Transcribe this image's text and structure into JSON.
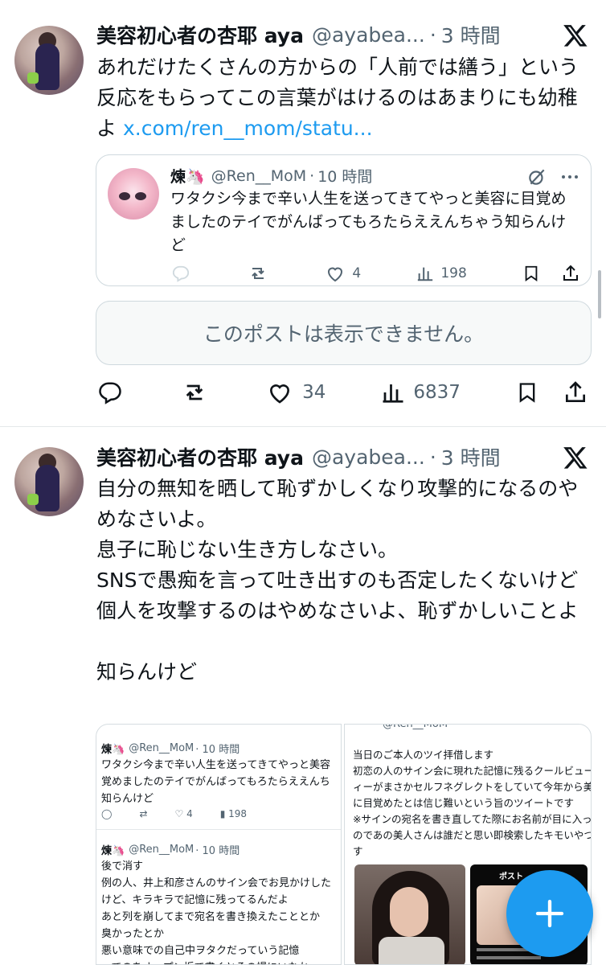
{
  "post1": {
    "author_name": "美容初心者の杏耶 aya",
    "handle": "@ayabea...",
    "dot": "·",
    "time": "3 時間",
    "text": "あれだけたくさんの方からの「人前では繕う」という反応をもらってこの言葉がはけるのはあまりにも幼稚よ ",
    "link": "x.com/ren__mom/statu...",
    "quote": {
      "author_name": "煉🦄",
      "handle": "@Ren__MoM",
      "dot": "·",
      "time": "10 時間",
      "text": "ワタクシ今まで辛い人生を送ってきてやっと美容に目覚めましたのテイでがんばってもろたらええんちゃう知らんけど",
      "likes": "4",
      "views": "198"
    },
    "unavailable": "このポストは表示できません。",
    "likes": "34",
    "views": "6837"
  },
  "post2": {
    "author_name": "美容初心者の杏耶 aya",
    "handle": "@ayabea...",
    "dot": "·",
    "time": "3 時間",
    "text": "自分の無知を晒して恥ずかしくなり攻撃的になるのやめなさいよ。\n息子に恥じない生き方しなさい。\nSNSで愚痴を言って吐き出すのも否定したくないけど個人を攻撃するのはやめなさいよ、恥ずかしいことよ\n\n知らんけど",
    "media_left": {
      "tweet1_name": "煉🦄",
      "tweet1_handle": "@Ren__MoM",
      "tweet1_time": "· 10 時間",
      "tweet1_text": "ワタクシ今まで辛い人生を送ってきてやっと美容\n覚めましたのテイでがんばってもろたらええんち\n知らんけど",
      "tweet1_likes": "4",
      "tweet1_views": "198",
      "tweet2_name": "煉🦄",
      "tweet2_handle": "@Ren__MoM",
      "tweet2_time": "· 10 時間",
      "tweet2_text": "後で消す\n例の人、井上和彦さんのサイン会でお見かけした\nけど、キラキラで記憶に残ってるんだよ\nあと列を崩してまで宛名を書き換えたこととか\n臭かったとか\n悪い意味での自己中ヲタクだっていう記憶\nってのをオープン垢で書くとその場にいなかっ"
    },
    "media_right": {
      "top_handle": "@Ren__MoM",
      "text": "当日のご本人のツイ拝借します\n初恋の人のサイン会に現れた記憶に残るクールビューテ\nィーがまさかセルフネグレクトをしていて今年から美容\nに目覚めたとは信じ難いという旨のツイートです\n※サインの宛名を書き直してた際にお名前が目に入った\nのであの美人さんは誰だと思い即検索したキモいやつです\nす",
      "small_label": "ポスト"
    }
  },
  "colors": {
    "accent": "#1d9bf0",
    "text": "#0f1419",
    "secondary": "#536471",
    "border": "#cfd9de"
  },
  "icons": [
    "x-logo-icon",
    "reply-icon",
    "repost-icon",
    "like-icon",
    "views-icon",
    "bookmark-icon",
    "share-icon",
    "grok-icon",
    "more-icon",
    "plus-icon"
  ]
}
